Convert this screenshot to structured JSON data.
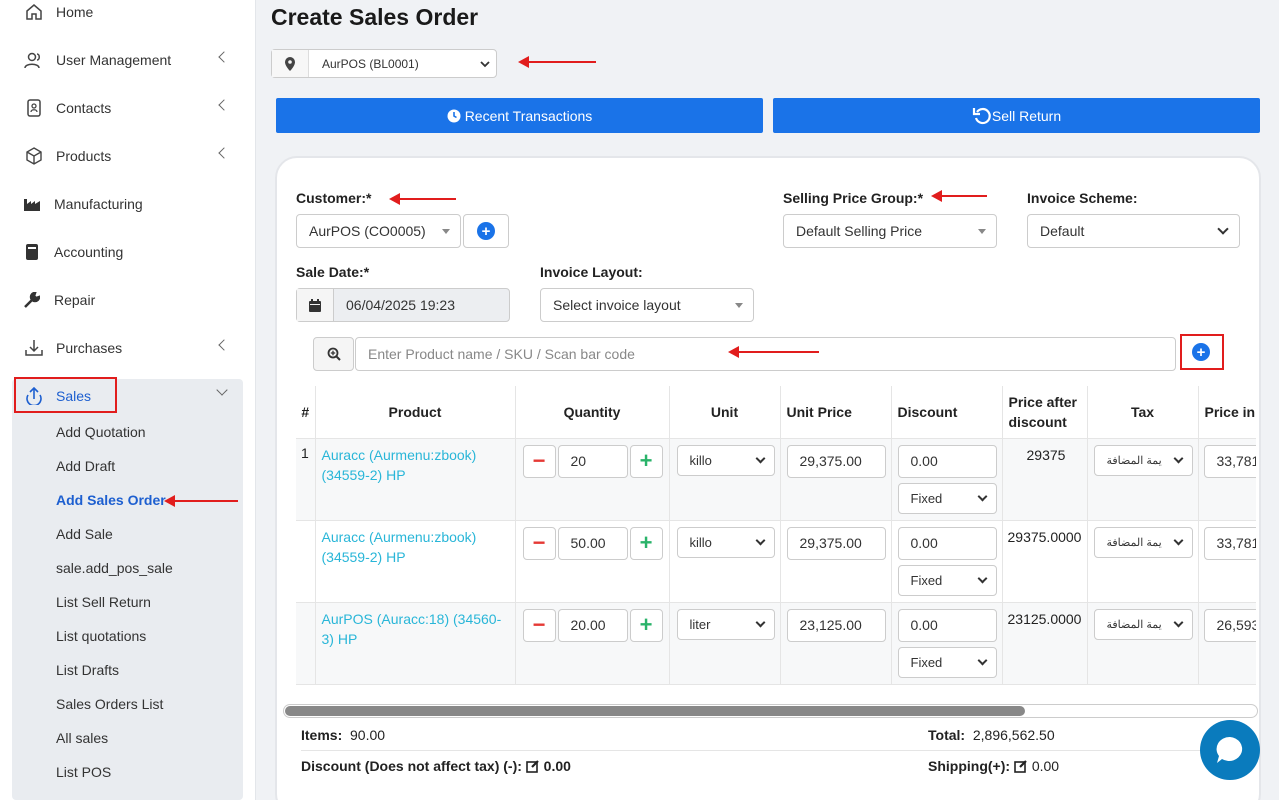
{
  "sidebar": {
    "items": [
      {
        "label": "Home",
        "icon": "home-icon"
      },
      {
        "label": "User Management",
        "icon": "users-icon"
      },
      {
        "label": "Contacts",
        "icon": "contacts-icon"
      },
      {
        "label": "Products",
        "icon": "cube-icon"
      },
      {
        "label": "Manufacturing",
        "icon": "factory-icon"
      },
      {
        "label": "Accounting",
        "icon": "book-icon"
      },
      {
        "label": "Repair",
        "icon": "wrench-icon"
      },
      {
        "label": "Purchases",
        "icon": "download-icon"
      },
      {
        "label": "Sales",
        "icon": "upload-icon"
      }
    ],
    "sales_sub": [
      "Add Quotation",
      "Add Draft",
      "Add Sales Order",
      "Add Sale",
      "sale.add_pos_sale",
      "List Sell Return",
      "List quotations",
      "List Drafts",
      "Sales Orders List",
      "All sales",
      "List POS"
    ]
  },
  "page": {
    "title": "Create Sales Order",
    "location": "AurPOS (BL0001)",
    "recent_transactions": "Recent Transactions",
    "sell_return": "Sell Return"
  },
  "form": {
    "customer_label": "Customer:*",
    "customer_value": "AurPOS (CO0005)",
    "price_group_label": "Selling Price Group:*",
    "price_group_value": "Default Selling Price",
    "invoice_scheme_label": "Invoice Scheme:",
    "invoice_scheme_value": "Default",
    "sale_date_label": "Sale Date:*",
    "sale_date_value": "06/04/2025 19:23",
    "invoice_layout_label": "Invoice Layout:",
    "invoice_layout_value": "Select invoice layout",
    "search_placeholder": "Enter Product name / SKU / Scan bar code"
  },
  "table": {
    "headers": [
      "#",
      "Product",
      "Quantity",
      "Unit",
      "Unit Price",
      "Discount",
      "Price after discount",
      "Tax",
      "Price in"
    ],
    "rows": [
      {
        "num": "1",
        "product": "Auracc (Aurmenu:zbook) (34559-2) HP",
        "qty": "20",
        "unit": "killo",
        "unit_price": "29,375.00",
        "discount": "0.00",
        "discount_type": "Fixed",
        "price_after": "29375",
        "tax": "يمة المضافة",
        "price_inc": "33,781"
      },
      {
        "num": "",
        "product": "Auracc (Aurmenu:zbook) (34559-2) HP",
        "qty": "50.00",
        "unit": "killo",
        "unit_price": "29,375.00",
        "discount": "0.00",
        "discount_type": "Fixed",
        "price_after": "29375.0000",
        "tax": "يمة المضافة",
        "price_inc": "33,781"
      },
      {
        "num": "",
        "product": "AurPOS (Auracc:18) (34560-3) HP",
        "qty": "20.00",
        "unit": "liter",
        "unit_price": "23,125.00",
        "discount": "0.00",
        "discount_type": "Fixed",
        "price_after": "23125.0000",
        "tax": "يمة المضافة",
        "price_inc": "26,593"
      }
    ]
  },
  "footer": {
    "items_label": "Items:",
    "items_value": "90.00",
    "total_label": "Total:",
    "total_value": "2,896,562.50",
    "discount_label": "Discount (Does not affect tax) (-):",
    "discount_value": "0.00",
    "shipping_label": "Shipping(+):",
    "shipping_value": "0.00"
  },
  "colors": {
    "primary": "#1a73e8",
    "annotation_red": "#e11d1d",
    "link": "#29b6d8",
    "active_nav": "#1d5fd0"
  }
}
